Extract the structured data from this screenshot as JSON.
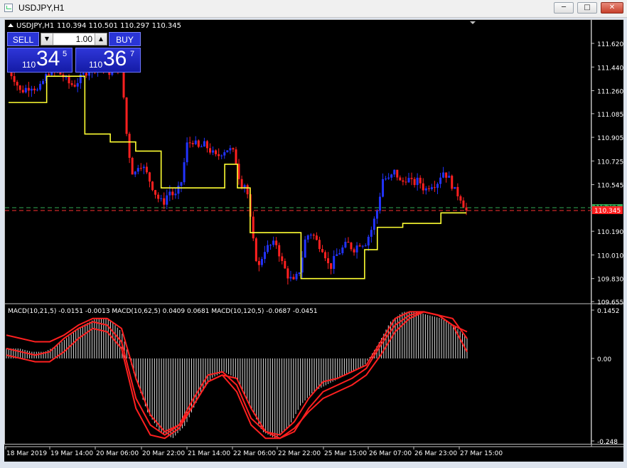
{
  "window": {
    "title": "USDJPY,H1",
    "minimize": "─",
    "maximize": "□",
    "close": "✕"
  },
  "chart_header": {
    "symbol": "USDJPY,H1",
    "ohlc": "110.394 110.501 110.297 110.345"
  },
  "trade_panel": {
    "sell_label": "SELL",
    "buy_label": "BUY",
    "lot": "1.00",
    "sell_prefix": "110",
    "sell_big": "34",
    "sell_sup": "5",
    "buy_prefix": "110",
    "buy_big": "36",
    "buy_sup": "7"
  },
  "price_axis": [
    "111.620",
    "111.440",
    "111.260",
    "111.085",
    "110.905",
    "110.725",
    "110.545",
    "110.190",
    "110.010",
    "109.830",
    "109.655"
  ],
  "current_price_label": "110.345",
  "ask_label": "110.367",
  "indicator_label": "MACD(10,21,5) -0.0151 -0.0013  MACD(10,62,5) 0.0409 0.0681  MACD(10,120,5) -0.0687 -0.0451",
  "macd_axis": [
    "0.1452",
    "0.00",
    "-0.248"
  ],
  "time_axis": [
    "18 Mar 2019",
    "19 Mar 14:00",
    "20 Mar 06:00",
    "20 Mar 22:00",
    "21 Mar 14:00",
    "22 Mar 06:00",
    "22 Mar 22:00",
    "25 Mar 15:00",
    "26 Mar 07:00",
    "26 Mar 23:00",
    "27 Mar 15:00"
  ],
  "colors": {
    "bull": "#2233ff",
    "bear": "#ff2020",
    "line": "#ffff33",
    "macd": "#ff2020",
    "bid_line": "#ff3030",
    "ask_line": "#33aa55"
  },
  "chart_data": {
    "type": "candlestick",
    "symbol": "USDJPY",
    "timeframe": "H1",
    "price_range": [
      109.655,
      111.62
    ],
    "close_path": [
      111.42,
      111.35,
      111.25,
      111.28,
      111.3,
      111.25,
      111.35,
      111.42,
      111.4,
      111.38,
      111.32,
      111.3,
      111.35,
      111.4,
      111.44,
      111.45,
      111.43,
      111.4,
      111.45,
      111.42,
      110.85,
      110.6,
      110.72,
      110.65,
      110.55,
      110.45,
      110.4,
      110.5,
      110.45,
      110.55,
      110.85,
      110.88,
      110.82,
      110.85,
      110.8,
      110.75,
      110.8,
      110.82,
      110.78,
      110.55,
      110.55,
      110.15,
      109.9,
      110.05,
      110.08,
      110.1,
      109.95,
      109.85,
      109.8,
      109.9,
      110.15,
      110.18,
      110.1,
      110.05,
      109.9,
      110.0,
      110.05,
      110.1,
      110.05,
      110.1,
      110.1,
      110.2,
      110.35,
      110.6,
      110.58,
      110.65,
      110.55,
      110.6,
      110.55,
      110.58,
      110.5,
      110.55,
      110.55,
      110.65,
      110.6,
      110.5,
      110.45,
      110.345
    ],
    "yellow_line": [
      111.17,
      111.17,
      111.17,
      111.37,
      111.37,
      111.37,
      110.93,
      110.93,
      110.87,
      110.87,
      110.8,
      110.8,
      110.52,
      110.52,
      110.52,
      110.52,
      110.52,
      110.7,
      110.52,
      110.18,
      110.18,
      110.18,
      110.18,
      109.83,
      109.83,
      109.83,
      109.83,
      109.83,
      110.05,
      110.22,
      110.22,
      110.25,
      110.25,
      110.25,
      110.33,
      110.33
    ],
    "macd_range": [
      -0.248,
      0.1452
    ],
    "macd_series": [
      {
        "values": [
          0.03,
          0.02,
          0.01,
          0.02,
          0.06,
          0.09,
          0.11,
          0.1,
          0.05,
          -0.12,
          -0.2,
          -0.23,
          -0.2,
          -0.12,
          -0.05,
          -0.04,
          -0.08,
          -0.18,
          -0.22,
          -0.23,
          -0.19,
          -0.12,
          -0.07,
          -0.06,
          -0.04,
          -0.02,
          0.05,
          0.12,
          0.14,
          0.14,
          0.13,
          0.12,
          0.06
        ]
      },
      {
        "values": [
          0.01,
          0.0,
          -0.01,
          -0.01,
          0.02,
          0.06,
          0.09,
          0.08,
          0.03,
          -0.15,
          -0.23,
          -0.24,
          -0.21,
          -0.14,
          -0.07,
          -0.05,
          -0.1,
          -0.2,
          -0.24,
          -0.24,
          -0.21,
          -0.16,
          -0.12,
          -0.1,
          -0.08,
          -0.05,
          0.01,
          0.08,
          0.12,
          0.14,
          0.13,
          0.1,
          0.02
        ]
      },
      {
        "values": [
          0.07,
          0.06,
          0.05,
          0.05,
          0.07,
          0.1,
          0.12,
          0.12,
          0.09,
          -0.06,
          -0.17,
          -0.22,
          -0.2,
          -0.14,
          -0.07,
          -0.05,
          -0.06,
          -0.15,
          -0.22,
          -0.24,
          -0.22,
          -0.15,
          -0.1,
          -0.08,
          -0.06,
          -0.03,
          0.04,
          0.1,
          0.13,
          0.14,
          0.13,
          0.1,
          0.08
        ]
      }
    ],
    "histogram": [
      0.03,
      0.03,
      0.02,
      0.02,
      0.04,
      0.07,
      0.1,
      0.12,
      0.12,
      0.08,
      -0.05,
      -0.16,
      -0.22,
      -0.24,
      -0.2,
      -0.12,
      -0.06,
      -0.04,
      -0.06,
      -0.14,
      -0.22,
      -0.24,
      -0.21,
      -0.14,
      -0.1,
      -0.08,
      -0.06,
      -0.04,
      -0.02,
      0.04,
      0.11,
      0.14,
      0.14,
      0.13,
      0.12,
      0.1,
      0.06
    ]
  }
}
